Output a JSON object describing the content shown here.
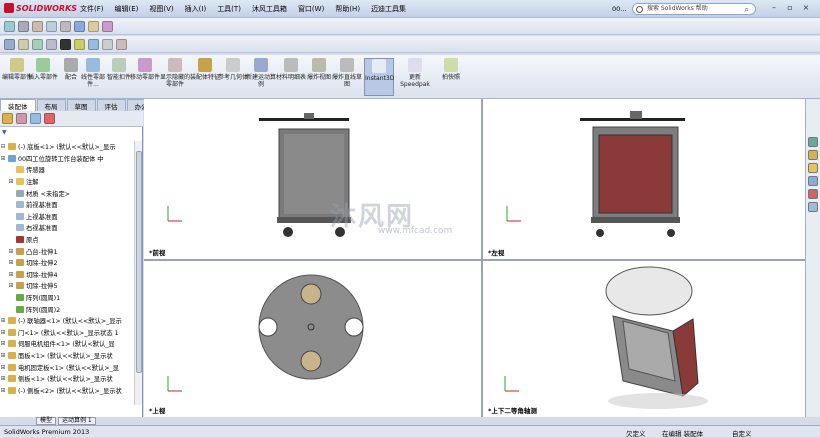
{
  "app": {
    "title": "SOLIDWORKS",
    "search_placeholder": "搜索 SolidWorks 帮助",
    "doc_short": "00..."
  },
  "menu": [
    "文件(F)",
    "编辑(E)",
    "视图(V)",
    "插入(I)",
    "工具(T)",
    "沐风工具箱",
    "窗口(W)",
    "帮助(H)",
    "迈迪工具集"
  ],
  "commands": [
    {
      "label": "编辑零部件"
    },
    {
      "label": "插入零部件"
    },
    {
      "label": "配合"
    },
    {
      "label": "线性零部件..."
    },
    {
      "label": "智能扣件"
    },
    {
      "label": "移动零部件"
    },
    {
      "label": "显示隐藏的零部件"
    },
    {
      "label": "装配体特征"
    },
    {
      "label": "参考几何体"
    },
    {
      "label": "新建运动算例"
    },
    {
      "label": "材料明细表"
    },
    {
      "label": "爆炸视图"
    },
    {
      "label": "爆炸直线草图"
    },
    {
      "label": "Instant3D",
      "active": true
    },
    {
      "label": "更新Speedpak"
    },
    {
      "label": "拍快照"
    }
  ],
  "cmd_tabs": [
    "装配体",
    "布局",
    "草图",
    "评估",
    "办公室产品"
  ],
  "tree": [
    {
      "exp": "⊟",
      "text": "(-) 底板<1> (默认<<默认>_显示",
      "color": "#d8b14a"
    },
    {
      "exp": "⊞",
      "text": "00四工位旋转工作台装配体 中",
      "color": "#6fa0d8"
    },
    {
      "exp": "",
      "text": "传感器",
      "color": "#e8c35a"
    },
    {
      "exp": "⊞",
      "text": "注解",
      "color": "#e8c35a"
    },
    {
      "exp": "",
      "text": "材质 <未指定>",
      "color": "#9aa"
    },
    {
      "exp": "",
      "text": "前视基准面",
      "color": "#a0b8d8"
    },
    {
      "exp": "",
      "text": "上视基准面",
      "color": "#a0b8d8"
    },
    {
      "exp": "",
      "text": "右视基准面",
      "color": "#a0b8d8"
    },
    {
      "exp": "",
      "text": "原点",
      "color": "#a33"
    },
    {
      "exp": "⊞",
      "text": "凸台-拉伸1",
      "color": "#c8a24a"
    },
    {
      "exp": "⊞",
      "text": "切除-拉伸2",
      "color": "#c8a24a"
    },
    {
      "exp": "⊞",
      "text": "切除-拉伸4",
      "color": "#c8a24a"
    },
    {
      "exp": "⊞",
      "text": "切除-拉伸5",
      "color": "#c8a24a"
    },
    {
      "exp": "",
      "text": "阵列(圆周)1",
      "color": "#6a4"
    },
    {
      "exp": "",
      "text": "阵列(圆周)2",
      "color": "#6a4"
    },
    {
      "exp": "⊞",
      "text": "(-) 联轴器<1> (默认<<默认>_显示",
      "color": "#d8b14a"
    },
    {
      "exp": "⊞",
      "text": "门<1> (默认<<默认>_显示状态 1",
      "color": "#d8b14a"
    },
    {
      "exp": "⊞",
      "text": "伺服电机组件<1> (默认<默认_显",
      "color": "#d8b14a"
    },
    {
      "exp": "⊞",
      "text": "面板<1> (默认<<默认>_显示状",
      "color": "#d8b14a"
    },
    {
      "exp": "⊞",
      "text": "电机固定板<1> (默认<<默认>_显",
      "color": "#d8b14a"
    },
    {
      "exp": "⊞",
      "text": "侧板<1> (默认<<默认>_显示状",
      "color": "#d8b14a"
    },
    {
      "exp": "⊞",
      "text": "(-) 侧板<2> (默认<<默认>_显示状",
      "color": "#d8b14a"
    }
  ],
  "bottom_tabs": [
    "模型",
    "运动算例 1"
  ],
  "views": {
    "front": "*前视",
    "left": "*左视",
    "top": "*上视",
    "iso": "*上下二等角轴测"
  },
  "watermark": {
    "text": "沐风网",
    "url": "www.mfcad.com"
  },
  "status": {
    "app": "SolidWorks Premium 2013",
    "state": "欠定义",
    "mode": "在编辑 装配体",
    "custom": "自定义"
  },
  "colors": {
    "accent": "#c8102e",
    "door": "#8b3a3a",
    "frame": "#8f8f8f"
  }
}
